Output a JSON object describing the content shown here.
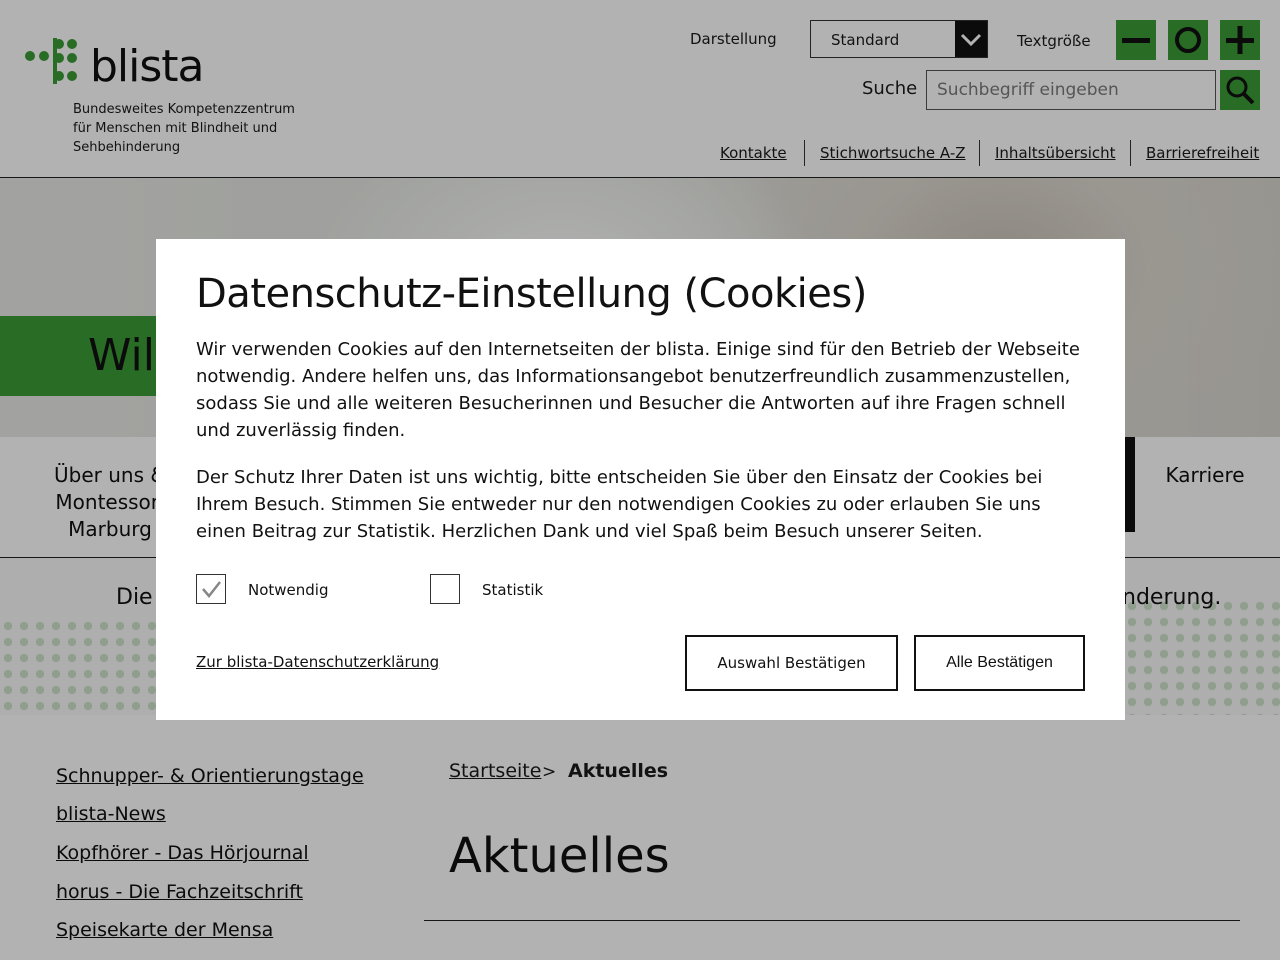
{
  "header": {
    "logo_text": "blista",
    "logo_tagline": [
      "Bundesweites Kompetenzzentrum",
      "für Menschen mit Blindheit und",
      "Sehbehinderung"
    ],
    "display_label": "Darstellung",
    "display_value": "Standard",
    "textsize_label": "Textgröße",
    "search_label": "Suche",
    "search_placeholder": "Suchbegriff eingeben",
    "links": [
      "Kontakte",
      "Stichwortsuche A-Z",
      "Inhaltsübersicht",
      "Barrierefreiheit"
    ]
  },
  "hero": {
    "welcome_text": "Wil"
  },
  "nav": {
    "items": [
      "Über uns &",
      "Montessori",
      "Marburg",
      "Karriere"
    ]
  },
  "banner": {
    "text_left": "Die",
    "text_right": "nderung."
  },
  "sidebar": {
    "links": [
      "Schnupper- & Orientierungstage",
      "blista-News",
      "Kopfhörer - Das Hörjournal",
      "horus - Die Fachzeitschrift",
      "Speisekarte der Mensa"
    ]
  },
  "content": {
    "breadcrumb_home": "Startseite",
    "breadcrumb_sep": ">",
    "breadcrumb_current": "Aktuelles",
    "title": "Aktuelles"
  },
  "cookie_modal": {
    "title": "Datenschutz-Einstellung (Cookies)",
    "paragraph1": "Wir verwenden Cookies auf den Internetseiten der blista. Einige sind für den Betrieb der Webseite notwendig. Andere helfen uns, das Informationsangebot benutzerfreundlich zusammenzustellen, sodass Sie und alle weiteren Besucherinnen und Besucher die Antworten auf ihre Fragen schnell und zuverlässig finden.",
    "paragraph2": "Der Schutz Ihrer Daten ist uns wichtig, bitte entscheiden Sie über den Einsatz der Cookies bei Ihrem Besuch. Stimmen Sie entweder nur den notwendigen Cookies zu oder erlauben Sie uns einen Beitrag zur Statistik. Herzlichen Dank und viel Spaß beim Besuch unserer Seiten.",
    "checkbox_necessary": "Notwendig",
    "checkbox_necessary_checked": true,
    "checkbox_statistics": "Statistik",
    "checkbox_statistics_checked": false,
    "privacy_link": "Zur blista-Datenschutzerklärung",
    "confirm_selection": "Auswahl Bestätigen",
    "confirm_all": "Alle Bestätigen"
  },
  "colors": {
    "brand_green": "#3a9b35",
    "overlay": "rgba(0,0,0,0.30)"
  },
  "icons": [
    "minus-icon",
    "circle-icon",
    "plus-icon",
    "search-icon",
    "chevron-down-icon",
    "checkmark-icon"
  ]
}
